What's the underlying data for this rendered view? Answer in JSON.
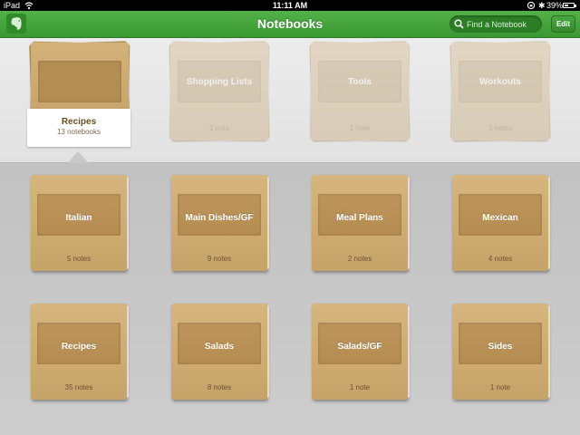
{
  "status_bar": {
    "carrier": "iPad",
    "time": "11:11 AM",
    "battery": "39%",
    "battery_level": 0.39
  },
  "nav": {
    "title": "Notebooks",
    "search_placeholder": "Find a Notebook",
    "edit_label": "Edit"
  },
  "stacks": [
    {
      "name": "Recipes",
      "count": "13 notebooks",
      "selected": true
    },
    {
      "name": "Shopping Lists",
      "count": "1 note",
      "selected": false
    },
    {
      "name": "Tools",
      "count": "1 note",
      "selected": false
    },
    {
      "name": "Workouts",
      "count": "3 notes",
      "selected": false
    }
  ],
  "notebooks": [
    {
      "name": "Italian",
      "count": "5 notes"
    },
    {
      "name": "Main Dishes/GF",
      "count": "9 notes"
    },
    {
      "name": "Meal Plans",
      "count": "2 notes"
    },
    {
      "name": "Mexican",
      "count": "4 notes"
    },
    {
      "name": "Recipes",
      "count": "35 notes"
    },
    {
      "name": "Salads",
      "count": "8 notes"
    },
    {
      "name": "Salads/GF",
      "count": "1 note"
    },
    {
      "name": "Sides",
      "count": "1 note"
    }
  ],
  "colors": {
    "nav_green": "#3f9c36",
    "notebook_cover": "#cfad72",
    "notebook_label": "#b68f53"
  }
}
